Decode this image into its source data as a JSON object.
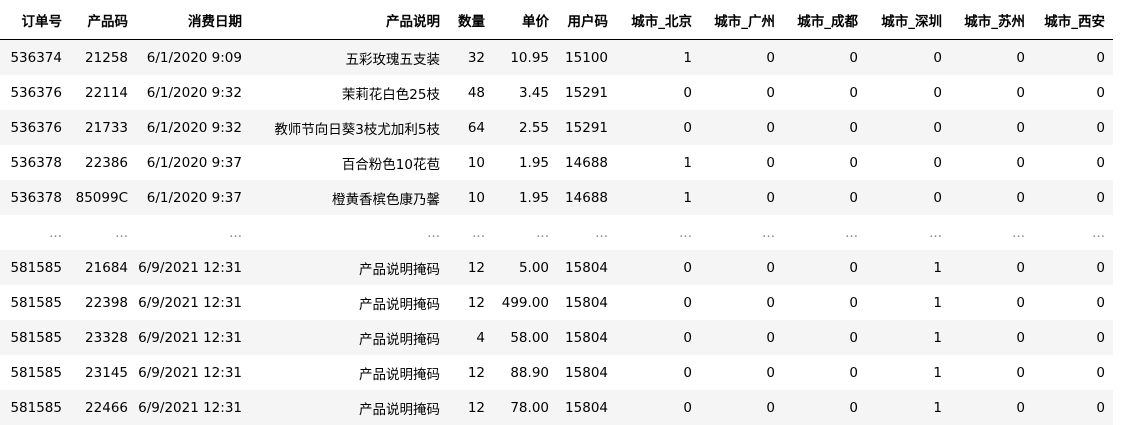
{
  "table": {
    "columns": [
      "订单号",
      "产品码",
      "消费日期",
      "产品说明",
      "数量",
      "单价",
      "用户码",
      "城市_北京",
      "城市_广州",
      "城市_成都",
      "城市_深圳",
      "城市_苏州",
      "城市_西安"
    ],
    "rows": [
      [
        "536374",
        "21258",
        "6/1/2020 9:09",
        "五彩玫瑰五支装",
        "32",
        "10.95",
        "15100",
        "1",
        "0",
        "0",
        "0",
        "0",
        "0"
      ],
      [
        "536376",
        "22114",
        "6/1/2020 9:32",
        "茉莉花白色25枝",
        "48",
        "3.45",
        "15291",
        "0",
        "0",
        "0",
        "0",
        "0",
        "0"
      ],
      [
        "536376",
        "21733",
        "6/1/2020 9:32",
        "教师节向日葵3枝尤加利5枝",
        "64",
        "2.55",
        "15291",
        "0",
        "0",
        "0",
        "0",
        "0",
        "0"
      ],
      [
        "536378",
        "22386",
        "6/1/2020 9:37",
        "百合粉色10花苞",
        "10",
        "1.95",
        "14688",
        "1",
        "0",
        "0",
        "0",
        "0",
        "0"
      ],
      [
        "536378",
        "85099C",
        "6/1/2020 9:37",
        "橙黄香槟色康乃馨",
        "10",
        "1.95",
        "14688",
        "1",
        "0",
        "0",
        "0",
        "0",
        "0"
      ],
      [
        "...",
        "...",
        "...",
        "...",
        "...",
        "...",
        "...",
        "...",
        "...",
        "...",
        "...",
        "...",
        "..."
      ],
      [
        "581585",
        "21684",
        "6/9/2021 12:31",
        "产品说明掩码",
        "12",
        "5.00",
        "15804",
        "0",
        "0",
        "0",
        "1",
        "0",
        "0"
      ],
      [
        "581585",
        "22398",
        "6/9/2021 12:31",
        "产品说明掩码",
        "12",
        "499.00",
        "15804",
        "0",
        "0",
        "0",
        "1",
        "0",
        "0"
      ],
      [
        "581585",
        "23328",
        "6/9/2021 12:31",
        "产品说明掩码",
        "4",
        "58.00",
        "15804",
        "0",
        "0",
        "0",
        "1",
        "0",
        "0"
      ],
      [
        "581585",
        "23145",
        "6/9/2021 12:31",
        "产品说明掩码",
        "12",
        "88.90",
        "15804",
        "0",
        "0",
        "0",
        "1",
        "0",
        "0"
      ],
      [
        "581585",
        "22466",
        "6/9/2021 12:31",
        "产品说明掩码",
        "12",
        "78.00",
        "15804",
        "0",
        "0",
        "0",
        "1",
        "0",
        "0"
      ]
    ]
  }
}
